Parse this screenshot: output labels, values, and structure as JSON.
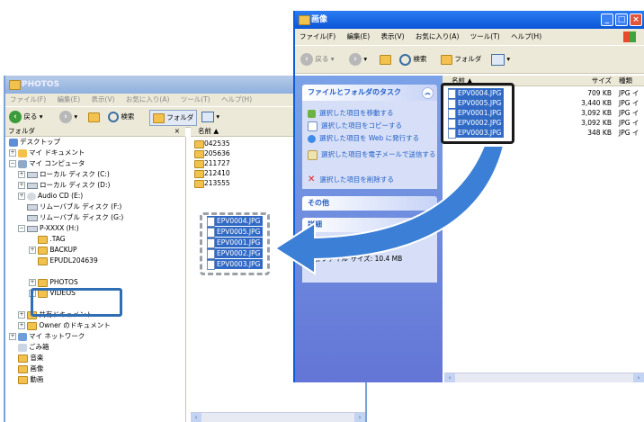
{
  "left_window": {
    "title": "PHOTOS",
    "menu": [
      "ファイル(F)",
      "編集(E)",
      "表示(V)",
      "お気に入り(A)",
      "ツール(T)",
      "ヘルプ(H)"
    ],
    "toolbar": {
      "back": "戻る",
      "search": "検索",
      "folders": "フォルダ"
    },
    "folder_pane_label": "フォルダ",
    "name_column": "名前",
    "tree": [
      {
        "label": "デスクトップ"
      },
      {
        "label": "マイ ドキュメント"
      },
      {
        "label": "マイ コンピュータ"
      },
      {
        "label": "ローカル ディスク (C:)"
      },
      {
        "label": "ローカル ディスク (D:)"
      },
      {
        "label": "Audio CD (E:)"
      },
      {
        "label": "リムーバブル ディスク (F:)"
      },
      {
        "label": "リムーバブル ディスク (G:)"
      },
      {
        "label": "P-XXXX (H:)"
      },
      {
        "label": ".TAG"
      },
      {
        "label": "BACKUP"
      },
      {
        "label": "EPUDL204639"
      },
      {
        "label": "PHOTOS"
      },
      {
        "label": "VIDEOS"
      },
      {
        "label": "共有ドキュメント"
      },
      {
        "label": "Owner のドキュメント"
      },
      {
        "label": "マイ ネットワーク"
      },
      {
        "label": "ごみ箱"
      },
      {
        "label": "音楽"
      },
      {
        "label": "画像"
      },
      {
        "label": "動画"
      }
    ],
    "folders": [
      "042535",
      "205636",
      "211727",
      "212410",
      "213555"
    ],
    "moved_files": [
      "EPV0004.JPG",
      "EPV0005.JPG",
      "EPV0001.JPG",
      "EPV0002.JPG",
      "EPV0003.JPG"
    ]
  },
  "right_window": {
    "title": "画像",
    "menu": [
      "ファイル(F)",
      "編集(E)",
      "表示(V)",
      "お気に入り(A)",
      "ツール(T)",
      "ヘルプ(H)"
    ],
    "toolbar": {
      "back": "戻る",
      "search": "検索",
      "folders": "フォルダ"
    },
    "tasks_title": "ファイルとフォルダのタスク",
    "tasks": [
      "選択した項目を移動する",
      "選択した項目をコピーする",
      "選択した項目を Web に発行する",
      "選択した項目を電子メールで送信する",
      "選択した項目を削除する"
    ],
    "other_title": "その他",
    "details_title": "詳細",
    "details_text": "合計ファイル サイズ: 10.4 MB",
    "columns": {
      "name": "名前",
      "size": "サイズ",
      "type": "種類"
    },
    "files": [
      {
        "name": "EPV0004.JPG",
        "size": "709 KB",
        "type": "JPG イ"
      },
      {
        "name": "EPV0005.JPG",
        "size": "3,440 KB",
        "type": "JPG イ"
      },
      {
        "name": "EPV0001.JPG",
        "size": "3,092 KB",
        "type": "JPG イ"
      },
      {
        "name": "EPV0002.JPG",
        "size": "3,092 KB",
        "type": "JPG イ"
      },
      {
        "name": "EPV0003.JPG",
        "size": "348 KB",
        "type": "JPG イ"
      }
    ]
  },
  "colors": {
    "selection": "#316ac5",
    "arrow": "#3b7fd6",
    "highlight": "#2f6db5"
  }
}
